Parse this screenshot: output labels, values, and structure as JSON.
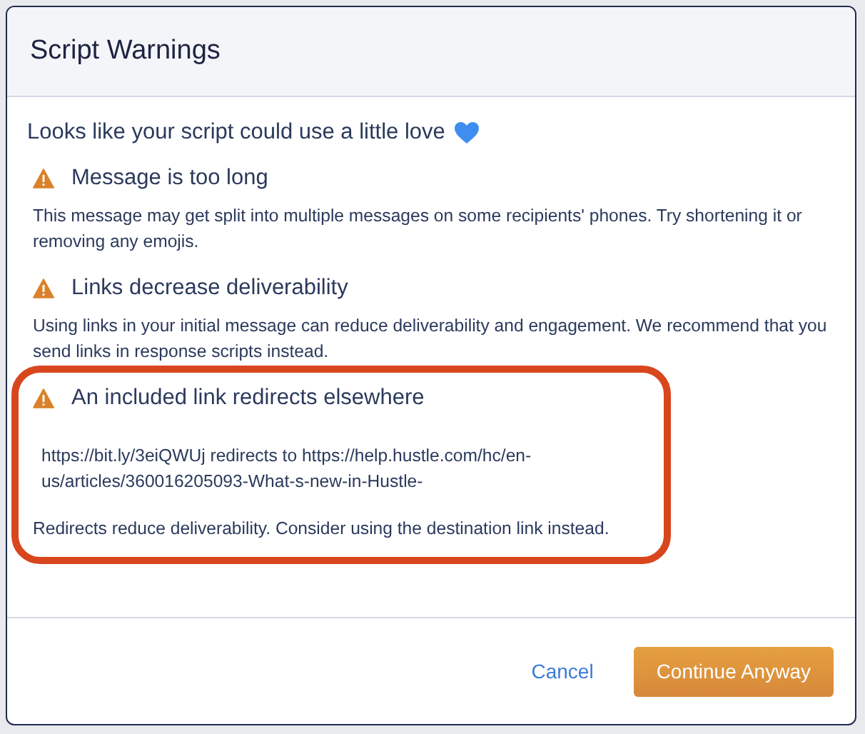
{
  "dialog": {
    "title": "Script Warnings",
    "intro": "Looks like your script could use a little love"
  },
  "warnings": [
    {
      "title": "Message is too long",
      "highlighted": false,
      "paragraphs": [
        {
          "kind": "note",
          "text": "This message may get split into multiple messages on some recipients' phones. Try shortening it or removing any emojis."
        }
      ]
    },
    {
      "title": "Links decrease deliverability",
      "highlighted": false,
      "paragraphs": [
        {
          "kind": "note",
          "text": "Using links in your initial message can reduce deliverability and engagement. We recommend that you send links in response scripts instead."
        }
      ]
    },
    {
      "title": "An included link redirects elsewhere",
      "highlighted": true,
      "paragraphs": [
        {
          "kind": "detail",
          "text": "https://bit.ly/3eiQWUj redirects to https://help.hustle.com/hc/en-us/articles/360016205093-What-s-new-in-Hustle-"
        },
        {
          "kind": "note",
          "text": "Redirects reduce deliverability. Consider using the destination link instead."
        }
      ]
    }
  ],
  "buttons": [
    {
      "label": "Cancel",
      "kind": "link"
    },
    {
      "label": "Continue Anyway",
      "kind": "primary"
    }
  ]
}
